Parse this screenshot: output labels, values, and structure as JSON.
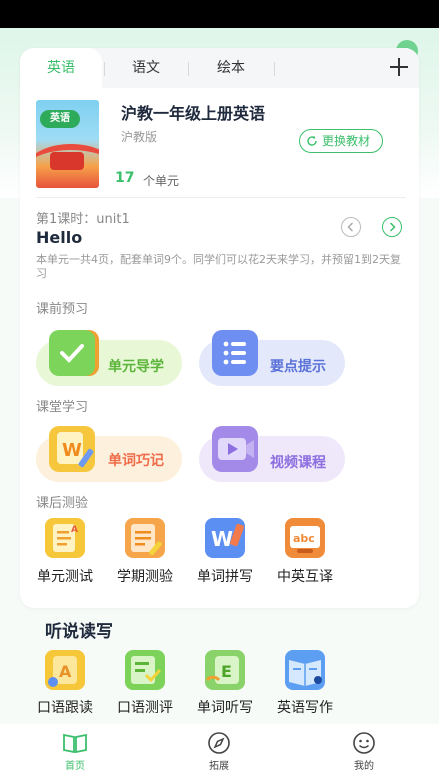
{
  "tabs": [
    "英语",
    "语文",
    "绘本"
  ],
  "book": {
    "cover_text": "英语",
    "title": "沪教一年级上册英语",
    "publisher": "沪教版",
    "change_button": "更换教材",
    "unit_count": "17",
    "unit_label": "个单元"
  },
  "lesson": {
    "line": "第1课时：unit1",
    "name": "Hello",
    "description": "本单元一共4页，配套单词9个。同学们可以花2天来学习，并预留1到2天复习"
  },
  "sections": {
    "preview": "课前预习",
    "classroom": "课堂学习",
    "after": "课后测验"
  },
  "preview_items": [
    "单元导学",
    "要点提示"
  ],
  "classroom_items": [
    "单词巧记",
    "视频课程"
  ],
  "test_items": [
    "单元测试",
    "学期测验",
    "单词拼写",
    "中英互译"
  ],
  "lstw": {
    "title": "听说读写",
    "items": [
      "口语跟读",
      "口语测评",
      "单词听写",
      "英语写作"
    ]
  },
  "bottom_nav": [
    "首页",
    "拓展",
    "我的"
  ],
  "colors": {
    "accent": "#3bbf6a",
    "preview_green": "#e8f8d6",
    "preview_blue": "#e3e9fb",
    "class_orange": "#fdf0dc",
    "class_purple": "#efe8fb"
  }
}
